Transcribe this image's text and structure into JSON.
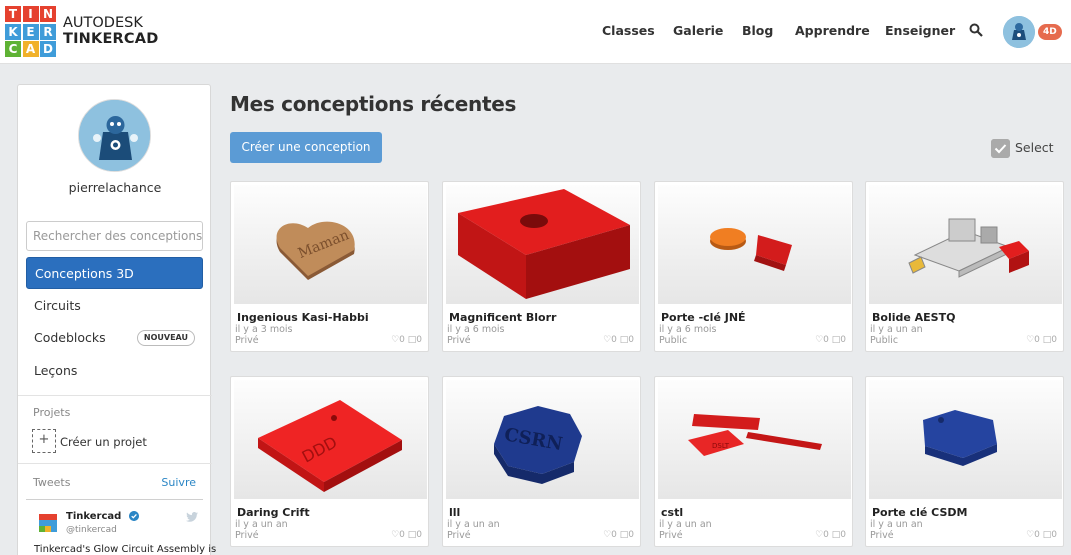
{
  "header": {
    "logo_letters": [
      "T",
      "I",
      "N",
      "K",
      "E",
      "R",
      "C",
      "A",
      "D"
    ],
    "logo_colors": [
      "#e5412f",
      "#e5412f",
      "#e5412f",
      "#3f9cd9",
      "#3f9cd9",
      "#3f9cd9",
      "#5fb234",
      "#f1b12a",
      "#3f9cd9"
    ],
    "brand_line1": "AUTODESK",
    "brand_line2": "TINKERCAD",
    "nav": [
      "Classes",
      "Galerie",
      "Blog",
      "Apprendre",
      "Enseigner"
    ],
    "badge": "4D"
  },
  "sidebar": {
    "username": "pierrelachance",
    "search_placeholder": "Rechercher des conceptions",
    "items": [
      {
        "label": "Conceptions 3D",
        "active": true
      },
      {
        "label": "Circuits"
      },
      {
        "label": "Codeblocks",
        "tag": "NOUVEAU"
      },
      {
        "label": "Leçons"
      }
    ],
    "projects_label": "Projets",
    "create_project": "Créer un projet",
    "tweets_label": "Tweets",
    "follow": "Suivre",
    "tweet": {
      "name": "Tinkercad",
      "handle": "@tinkercad",
      "text": "Tinkercad's Glow Circuit Assembly is"
    }
  },
  "main": {
    "title": "Mes conceptions récentes",
    "create_button": "Créer une conception",
    "select_label": "Select",
    "designs": [
      {
        "title": "Ingenious Kasi-Habbi",
        "date": "il y a 3 mois",
        "visibility": "Privé",
        "likes": "0",
        "comments": "0",
        "model": "heart"
      },
      {
        "title": "Magnificent Blorr",
        "date": "il y a 6 mois",
        "visibility": "Privé",
        "likes": "0",
        "comments": "0",
        "model": "redbox"
      },
      {
        "title": "Porte -clé JNÉ",
        "date": "il y a 6 mois",
        "visibility": "Public",
        "likes": "0",
        "comments": "0",
        "model": "keychain"
      },
      {
        "title": "Bolide AESTQ",
        "date": "il y a un an",
        "visibility": "Public",
        "likes": "0",
        "comments": "0",
        "model": "car"
      },
      {
        "title": "Daring Crift",
        "date": "il y a un an",
        "visibility": "Privé",
        "likes": "0",
        "comments": "0",
        "model": "redplate"
      },
      {
        "title": "lll",
        "date": "il y a un an",
        "visibility": "Privé",
        "likes": "0",
        "comments": "0",
        "model": "octagon"
      },
      {
        "title": "cstl",
        "date": "il y a un an",
        "visibility": "Privé",
        "likes": "0",
        "comments": "0",
        "model": "cstl"
      },
      {
        "title": "Porte clé CSDM",
        "date": "il y a un an",
        "visibility": "Privé",
        "likes": "0",
        "comments": "0",
        "model": "hexagon"
      }
    ]
  }
}
